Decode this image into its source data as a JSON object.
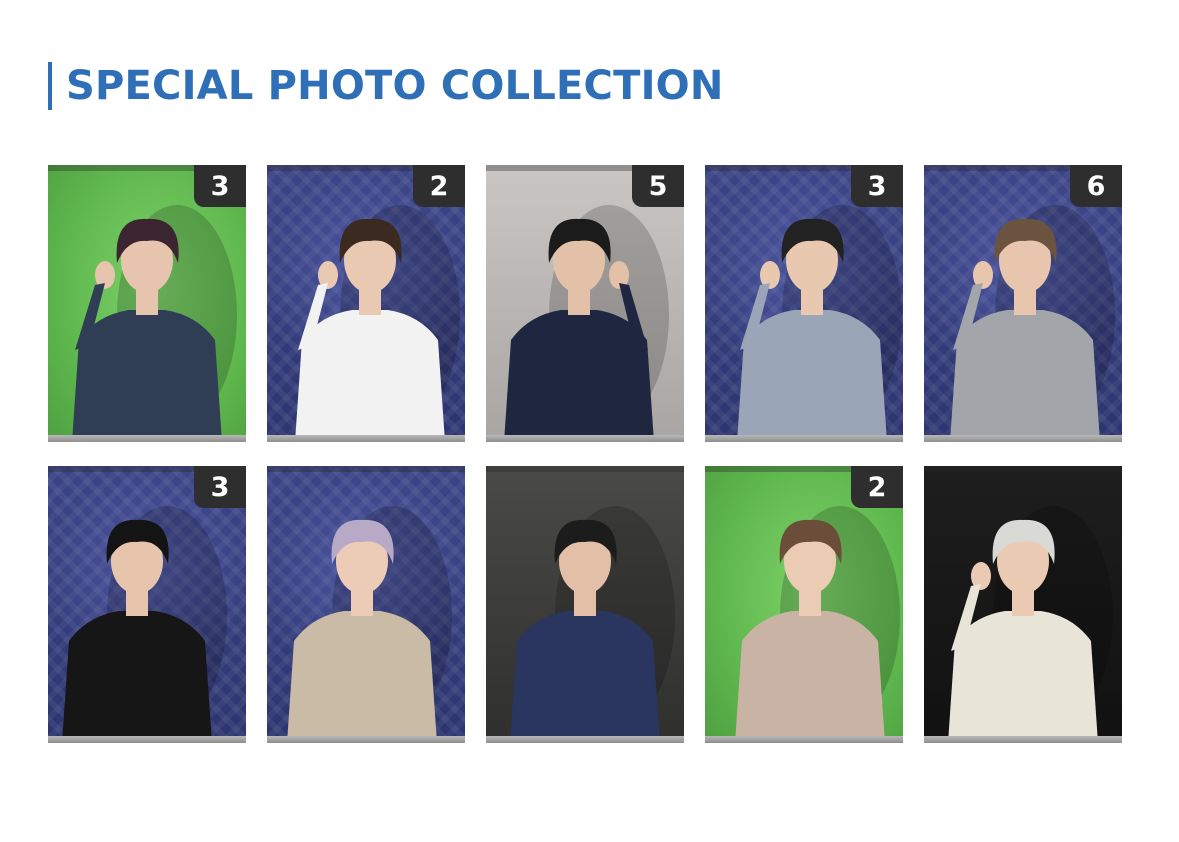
{
  "section": {
    "title": "SPECIAL PHOTO COLLECTION",
    "accent_color": "#2f6fb7"
  },
  "photos": [
    {
      "badge": "3",
      "background": "green",
      "hair": "#3a2530",
      "top": "#2f3d55",
      "skin": "#e6c4ad"
    },
    {
      "badge": "2",
      "background": "blue",
      "hair": "#3a2a20",
      "top": "#f2f2f2",
      "skin": "#eac9b2"
    },
    {
      "badge": "5",
      "background": "gray",
      "hair": "#1b1b1b",
      "top": "#1f2740",
      "skin": "#e3c1a8"
    },
    {
      "badge": "3",
      "background": "blue",
      "hair": "#222222",
      "top": "#9aa6b8",
      "skin": "#e9c8b0"
    },
    {
      "badge": "6",
      "background": "blue",
      "hair": "#6a5440",
      "top": "#a2a6ab",
      "skin": "#e8c6ae"
    },
    {
      "badge": "3",
      "background": "blue",
      "hair": "#141414",
      "top": "#161616",
      "skin": "#e7c5ad"
    },
    {
      "badge": "",
      "background": "blue",
      "hair": "#b8a9c7",
      "top": "#c9bba6",
      "skin": "#ecccb6"
    },
    {
      "badge": "",
      "background": "dark",
      "hair": "#1c1c1c",
      "top": "#2a3560",
      "skin": "#e2bfa6"
    },
    {
      "badge": "2",
      "background": "green",
      "hair": "#6b4e3a",
      "top": "#c9b3a5",
      "skin": "#eccbb5"
    },
    {
      "badge": "",
      "background": "black",
      "hair": "#d9d9d6",
      "top": "#e9e4d8",
      "skin": "#ebcab3"
    }
  ]
}
